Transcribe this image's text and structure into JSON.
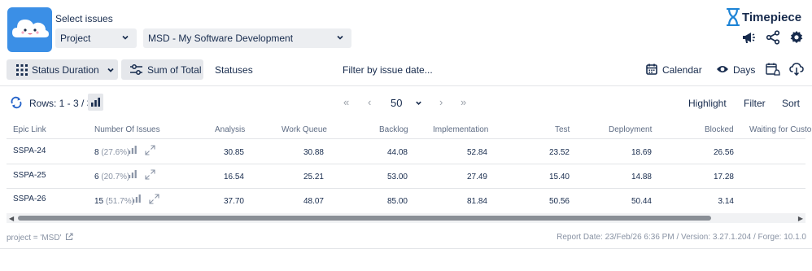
{
  "header": {
    "select_title": "Select issues",
    "project_type": "Project",
    "project_value": "MSD - My Software Development",
    "brand": "Timepiece"
  },
  "toolbar": {
    "status_duration": "Status Duration",
    "sum_of_total": "Sum of Total",
    "statuses": "Statuses",
    "filter_by_date": "Filter by issue date...",
    "calendar": "Calendar",
    "days": "Days"
  },
  "rowsbar": {
    "rows_label": "Rows: 1 - 3 / 3",
    "page_size": "50",
    "highlight": "Highlight",
    "filter": "Filter",
    "sort": "Sort"
  },
  "table": {
    "columns": [
      "Epic Link",
      "Number Of Issues",
      "Analysis",
      "Work Queue",
      "Backlog",
      "Implementation",
      "Test",
      "Deployment",
      "Blocked",
      "Waiting for Custo"
    ],
    "rows": [
      {
        "epic": "SSPA-24",
        "count": "8",
        "pct": "(27.6%)",
        "analysis": "30.85",
        "work_queue": "30.88",
        "backlog": "44.08",
        "implementation": "52.84",
        "test": "23.52",
        "deployment": "18.69",
        "blocked": "26.56"
      },
      {
        "epic": "SSPA-25",
        "count": "6",
        "pct": "(20.7%)",
        "analysis": "16.54",
        "work_queue": "25.21",
        "backlog": "53.00",
        "implementation": "27.49",
        "test": "15.40",
        "deployment": "14.88",
        "blocked": "17.28"
      },
      {
        "epic": "SSPA-26",
        "count": "15",
        "pct": "(51.7%)",
        "analysis": "37.70",
        "work_queue": "48.07",
        "backlog": "85.00",
        "implementation": "81.84",
        "test": "50.56",
        "deployment": "50.44",
        "blocked": "3.14"
      }
    ]
  },
  "footer": {
    "query": "project = 'MSD'",
    "report_info": "Report Date: 23/Feb/26 6:36 PM / Version: 3.27.1.204 / Forge: 10.1.0"
  },
  "icons": {
    "refresh": "refresh-icon",
    "bar_chart": "bar-chart-icon",
    "expand": "expand-icon",
    "calendar": "calendar-icon",
    "eye": "eye-icon",
    "megaphone": "megaphone-icon",
    "share": "share-icon",
    "gear": "gear-icon",
    "cloud": "cloud-icon"
  },
  "colors": {
    "accent": "#3b8fe6",
    "brand_blue": "#1e84d6",
    "refresh_blue": "#2563c9"
  }
}
